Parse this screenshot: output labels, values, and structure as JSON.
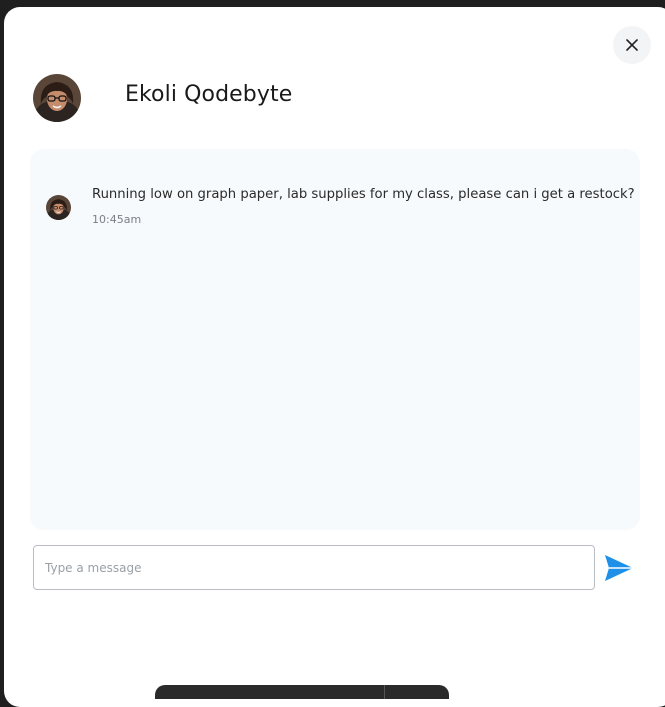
{
  "header": {
    "contact_name": "Ekoli Qodebyte",
    "avatar_icon": "profile-photo"
  },
  "close": {
    "icon": "close-icon"
  },
  "messages": [
    {
      "text": "Running low on graph paper, lab supplies for my class, please can i get a restock?",
      "time": "10:45am"
    }
  ],
  "composer": {
    "placeholder": "Type a message",
    "value": "",
    "send_icon": "send-icon"
  },
  "colors": {
    "accent": "#1e90e8",
    "chat_background": "#f7fafd",
    "modal_background": "#ffffff",
    "backdrop": "#1f1f1f"
  }
}
